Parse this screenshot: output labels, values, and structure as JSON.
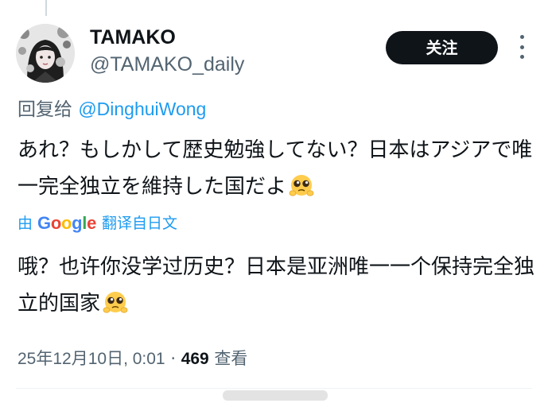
{
  "author": {
    "display_name": "TAMAKO",
    "handle": "@TAMAKO_daily"
  },
  "actions": {
    "follow_label": "关注",
    "more_icon": "more-vertical-icon"
  },
  "reply": {
    "prefix": "回复给",
    "mention": "@DinghuiWong"
  },
  "tweet": {
    "original_text": "あれ？もしかして歴史勉強してない？日本はアジアで唯一完全独立を維持した国だよ",
    "emoji": "pleading-face-emoji"
  },
  "translation": {
    "prefix": "由",
    "provider": "Google",
    "link_text": "翻译自日文",
    "text": "哦？也许你没学过历史？日本是亚洲唯一一个保持完全独立的国家"
  },
  "meta": {
    "timestamp": "25年12月10日, 0:01",
    "separator": "·",
    "views_count": "469",
    "views_label": "查看"
  },
  "colors": {
    "link_blue": "#1d9bf0",
    "secondary_text": "#536471",
    "primary_text": "#0f1419",
    "follow_button_bg": "#0f1419"
  }
}
